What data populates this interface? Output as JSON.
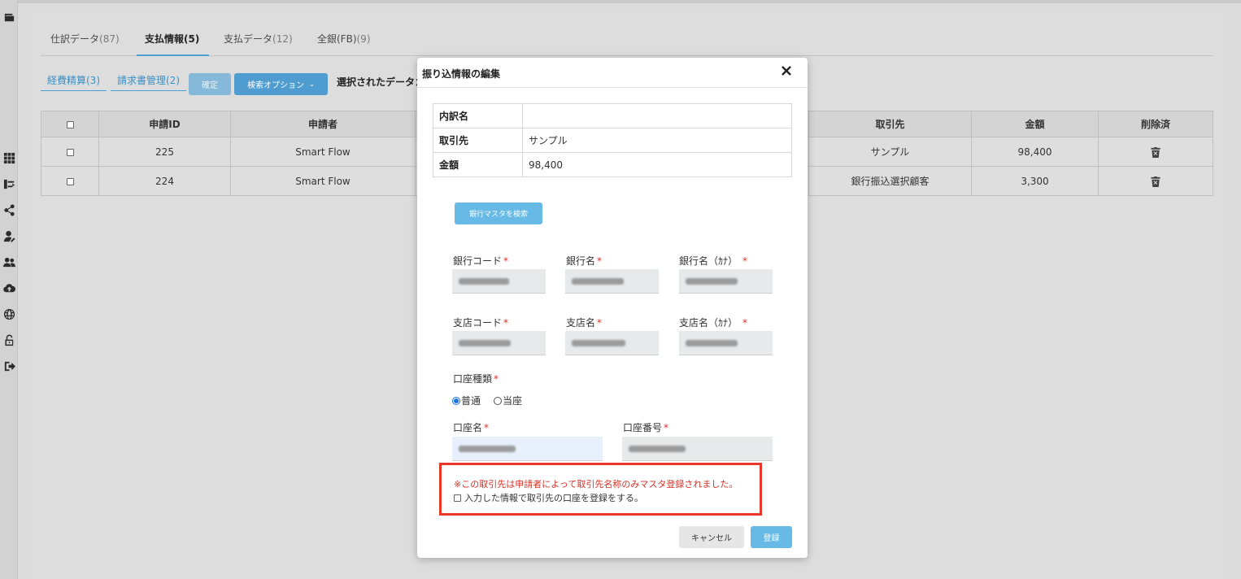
{
  "tabs": [
    {
      "label": "仕訳データ",
      "count": "(87)"
    },
    {
      "label": "支払情報",
      "count": "(5)"
    },
    {
      "label": "支払データ",
      "count": "(12)"
    },
    {
      "label": "全銀(FB)",
      "count": "(9)"
    }
  ],
  "sub_links": [
    "経費精算(3)",
    "請求書管理(2)"
  ],
  "toolbar": {
    "confirm_label": "確定",
    "search_options_label": "検索オプション",
    "selected_data_label": "選択されたデータ："
  },
  "table": {
    "headers": [
      "申請ID",
      "申請者",
      "取引先",
      "金額",
      "削除済"
    ],
    "rows": [
      {
        "id": "225",
        "applicant": "Smart Flow",
        "partner": "サンプル",
        "amount": "98,400"
      },
      {
        "id": "224",
        "applicant": "Smart Flow",
        "partner": "銀行振込選択顧客",
        "amount": "3,300"
      }
    ]
  },
  "modal": {
    "title": "振り込情報の編集",
    "info": [
      {
        "key": "内訳名",
        "value": ""
      },
      {
        "key": "取引先",
        "value": "サンプル"
      },
      {
        "key": "金額",
        "value": "98,400"
      }
    ],
    "bank_search_button": "銀行マスタを検索",
    "fields": {
      "bank_code": "銀行コード",
      "bank_name": "銀行名",
      "bank_name_kana": "銀行名（ｶﾅ）",
      "branch_code": "支店コード",
      "branch_name": "支店名",
      "branch_name_kana": "支店名（ｶﾅ）",
      "account_type": "口座種類",
      "account_name": "口座名",
      "account_number": "口座番号"
    },
    "account_type_options": [
      "普通",
      "当座"
    ],
    "account_type_selected": "普通",
    "notice": "※この取引先は申請者によって取引先名称のみマスタ登録されました。",
    "register_checkbox_label": "入力した情報で取引先の口座を登録をする。",
    "cancel_label": "キャンセル",
    "register_label": "登録"
  },
  "icons": [
    "wallet-icon",
    "grid-icon",
    "transfer-icon",
    "share-icon",
    "user-edit-icon",
    "users-icon",
    "cloud-upload-icon",
    "globe-icon",
    "lock-icon",
    "logout-icon",
    "trash-icon",
    "close-icon",
    "chevron-down-icon"
  ],
  "colors": {
    "accent": "#4e9cd0",
    "primary_button": "#67b9e6",
    "required": "#d93025",
    "highlight_border": "#e8382a"
  }
}
